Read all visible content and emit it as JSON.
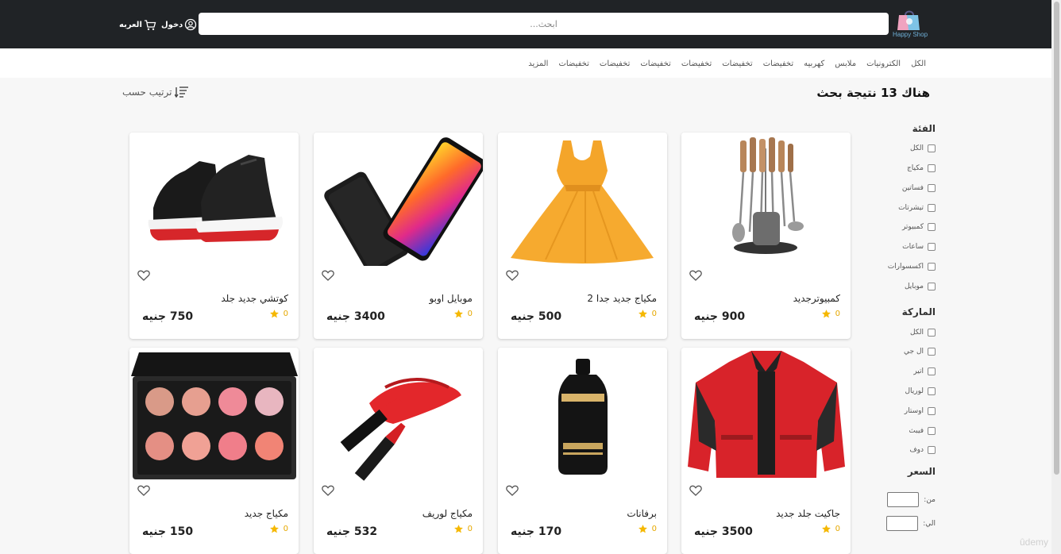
{
  "header": {
    "logo_text": "Happy Shop",
    "search_placeholder": "ابحث...",
    "login_label": "دخول",
    "lang_label": "العربه"
  },
  "nav": {
    "items": [
      "الكل",
      "الكترونيات",
      "ملابس",
      "كهربيه",
      "تخفيضات",
      "تخفيضات",
      "تخفيضات",
      "تخفيضات",
      "تخفيضات",
      "تخفيضات",
      "المزيد"
    ]
  },
  "results": {
    "title": "هناك 13 نتيجة بحث",
    "sort_label": "ترتيب حسب"
  },
  "filters": {
    "category_title": "الفئة",
    "categories": [
      "الكل",
      "مكياج",
      "فساتين",
      "تيشرتات",
      "كمبيوتر",
      "ساعات",
      "اكسسوارات",
      "موبايل"
    ],
    "brand_title": "الماركة",
    "brands": [
      "الكل",
      "ال جي",
      "اتير",
      "لوريال",
      "اوستار",
      "فيبث",
      "دوف"
    ],
    "price_title": "السعر",
    "from_label": "من:",
    "to_label": "الي:"
  },
  "products": [
    {
      "name": "كمبيوترجديد",
      "rating": "0",
      "price": "900 جنيه",
      "image": "kitchen-utensils"
    },
    {
      "name": "مكياج جديد جدا 2",
      "rating": "0",
      "price": "500 جنيه",
      "image": "yellow-dress"
    },
    {
      "name": "موبايل اوبو",
      "rating": "0",
      "price": "3400 جنيه",
      "image": "smartphone"
    },
    {
      "name": "كوتشي جديد جلد",
      "rating": "0",
      "price": "750 جنيه",
      "image": "sneakers"
    },
    {
      "name": "جاكيت جلد جديد",
      "rating": "0",
      "price": "3500 جنيه",
      "image": "red-jacket"
    },
    {
      "name": "برفانات",
      "rating": "0",
      "price": "170 جنيه",
      "image": "shampoo-bottle"
    },
    {
      "name": "مكياج لوريف",
      "rating": "0",
      "price": "532 جنيه",
      "image": "lipstick"
    },
    {
      "name": "مكياج جديد",
      "rating": "0",
      "price": "150 جنيه",
      "image": "blush-palette"
    }
  ],
  "colors": {
    "header_bg": "#202326",
    "star": "#f5b800",
    "page_bg": "#f7f7f7"
  },
  "watermark": "ûdemy"
}
